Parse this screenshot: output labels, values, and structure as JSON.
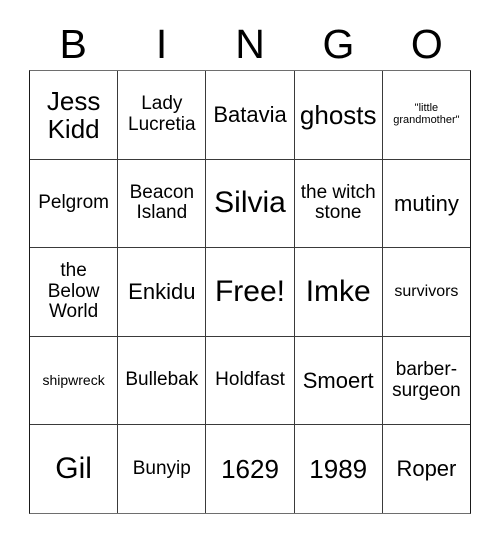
{
  "card": {
    "title_letters": [
      "B",
      "I",
      "N",
      "G",
      "O"
    ],
    "columns": 5,
    "rows": 5,
    "free_space_label": "Free!",
    "colors": {
      "background": "#ffffff",
      "text": "#000000",
      "grid_line": "#3a3a3a"
    },
    "cells": [
      [
        {
          "text": "Jess Kidd",
          "size": "xl"
        },
        {
          "text": "Lady Lucretia",
          "size": "m"
        },
        {
          "text": "Batavia",
          "size": "l"
        },
        {
          "text": "ghosts",
          "size": "xl"
        },
        {
          "text": "\"little grandmother\"",
          "size": "xxs"
        }
      ],
      [
        {
          "text": "Pelgrom",
          "size": "m"
        },
        {
          "text": "Beacon Island",
          "size": "m"
        },
        {
          "text": "Silvia",
          "size": "xxl"
        },
        {
          "text": "the witch stone",
          "size": "m"
        },
        {
          "text": "mutiny",
          "size": "l"
        }
      ],
      [
        {
          "text": "the Below World",
          "size": "m"
        },
        {
          "text": "Enkidu",
          "size": "l"
        },
        {
          "text": "Free!",
          "size": "xxl"
        },
        {
          "text": "Imke",
          "size": "xxl"
        },
        {
          "text": "survivors",
          "size": "s"
        }
      ],
      [
        {
          "text": "shipwreck",
          "size": "xs"
        },
        {
          "text": "Bullebak",
          "size": "m"
        },
        {
          "text": "Holdfast",
          "size": "m"
        },
        {
          "text": "Smoert",
          "size": "l"
        },
        {
          "text": "barber- surgeon",
          "size": "m"
        }
      ],
      [
        {
          "text": "Gil",
          "size": "xxl"
        },
        {
          "text": "Bunyip",
          "size": "m"
        },
        {
          "text": "1629",
          "size": "xl"
        },
        {
          "text": "1989",
          "size": "xl"
        },
        {
          "text": "Roper",
          "size": "l"
        }
      ]
    ]
  }
}
